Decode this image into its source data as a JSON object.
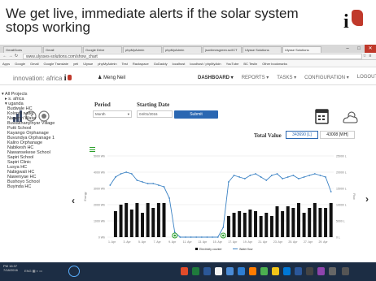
{
  "slide": {
    "title": "We get live, immediate alerts if the solar system stops working"
  },
  "browser": {
    "tabs": [
      {
        "label": "GmailGoes"
      },
      {
        "label": "Gmail"
      },
      {
        "label": "Google Drive"
      },
      {
        "label": "phpMyAdmin"
      },
      {
        "label": "phpMyAdmin"
      },
      {
        "label": "jsonlimesgreen.sc/ICT"
      },
      {
        "label": "Ulysse Solutions"
      },
      {
        "label": "Ulysse Solutions",
        "active": true
      }
    ],
    "url": "www.ulysses-solutions.com/show_chart",
    "bookmarks": [
      "Apps",
      "Google",
      "Gmail",
      "Google Translate",
      "yeti",
      "Ulysse",
      "phpMyAdmin",
      "Test",
      "Rackspace",
      "GoDaddy",
      "localhost",
      "localhost / phpMyAdn",
      "YouTube",
      "BC Teslin",
      "Other bookmarks"
    ]
  },
  "nav": {
    "brand": "innovation: africa",
    "brand_mark": "i",
    "user": "Meng Neil",
    "menu": [
      {
        "label": "DASHBOARD",
        "active": true
      },
      {
        "label": "REPORTS"
      },
      {
        "label": "TASKS"
      },
      {
        "label": "CONFIGURATION"
      },
      {
        "label": "LOGOUT"
      }
    ]
  },
  "sidebar": {
    "root": "All Projects",
    "countries": [
      "s. africa",
      "uganda"
    ],
    "sites": [
      "Budwale HC",
      "Kolonyi water",
      "Nasenyi Water",
      "Buwakhanyinyar Village",
      "Putti School",
      "Kayango Orphanage",
      "Buvundya Orphanage 1",
      "Kaliro Orphanage",
      "Nabikesh HC",
      "Nawansekese School",
      "Sapiri School",
      "Sapiri Clinic",
      "Lusya HC",
      "Nabigwali HC",
      "Nawenyae HC",
      "Bushoyo School",
      "Buyinda HC"
    ]
  },
  "filters": {
    "period_label": "Period",
    "period_value": "Month",
    "start_label": "Starting Date",
    "start_value": "04/01/2016",
    "submit_label": "Submit"
  },
  "totals": {
    "label": "Total Value",
    "water": "343690 [L]",
    "energy": "43008 [WH]"
  },
  "chart_data": {
    "type": "bar",
    "ylabel_left": "Energy",
    "ylabel_right": "Flow",
    "left_ticks": [
      "5000 Wh",
      "4000 Wh",
      "3000 Wh",
      "2000 Wh",
      "1000 Wh",
      "0 Wh"
    ],
    "right_ticks": [
      "25000 L",
      "20000 L",
      "15000 L",
      "10000 L",
      "5000 L",
      "0 L"
    ],
    "left_max": 5000,
    "right_max": 25000,
    "x": [
      "1. Apr",
      "3. Apr",
      "5. Apr",
      "7. Apr",
      "9. Apr",
      "11. Apr",
      "13. Apr",
      "15. Apr",
      "17. Apr",
      "19. Apr",
      "21. Apr",
      "23. Apr",
      "25. Apr",
      "27. Apr",
      "29. Apr"
    ],
    "legend": [
      "Electricity counter",
      "Water flow"
    ],
    "series": [
      {
        "name": "Electricity counter",
        "kind": "bar",
        "color": "#111111",
        "values": [
          0,
          1600,
          2000,
          2100,
          1700,
          2100,
          1500,
          2100,
          1800,
          2100,
          2100,
          0,
          0,
          0,
          0,
          0,
          0,
          0,
          0,
          0,
          0,
          0,
          1300,
          1500,
          1600,
          1500,
          1700,
          1600,
          1300,
          1500,
          1300,
          1900,
          1600,
          1900,
          1800,
          2100,
          1500,
          1800,
          2100,
          1800,
          1800,
          2100
        ]
      },
      {
        "name": "Water flow",
        "kind": "line",
        "color": "#3b82c4",
        "values": [
          16000,
          18500,
          19500,
          20000,
          19500,
          17500,
          17000,
          16500,
          16500,
          16000,
          15500,
          12000,
          1500,
          0,
          0,
          0,
          0,
          0,
          0,
          0,
          0,
          3000,
          17000,
          19000,
          18500,
          18000,
          19000,
          19500,
          18500,
          17500,
          19000,
          19500,
          18000,
          18500,
          19000,
          18000,
          18500,
          19000,
          19500,
          19000,
          18500,
          14000
        ]
      }
    ],
    "alert_markers": [
      12,
      21
    ]
  },
  "taskbar": {
    "time": "PM 16:37",
    "date": "7/18/2016",
    "lang": "ENG"
  },
  "colors": {
    "accent": "#2a67b2",
    "alert": "#2ca02c",
    "taskbar": "#1c2d44"
  }
}
